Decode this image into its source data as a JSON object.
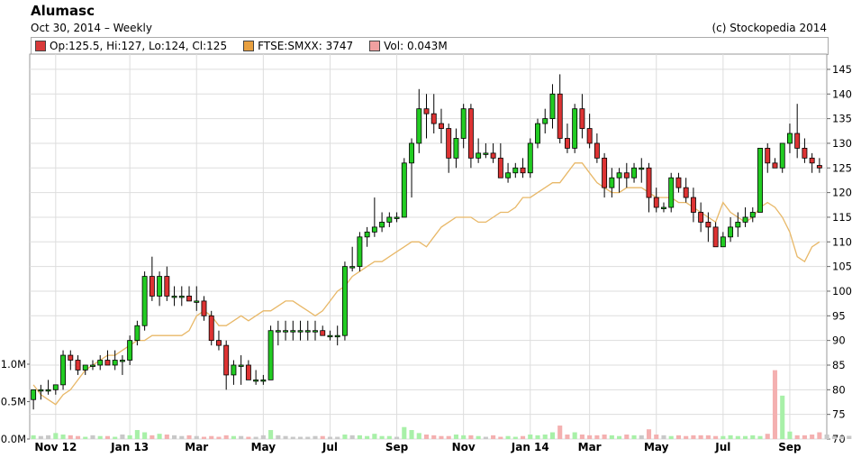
{
  "header": {
    "title": "Alumasc",
    "subtitle": "Oct 30, 2014 – Weekly",
    "copyright": "(c) Stockopedia 2014"
  },
  "legend": [
    {
      "label": "Op:125.5, Hi:127, Lo:124, Cl:125",
      "color": "#d93a3a"
    },
    {
      "label": "FTSE:SMXX: 3747",
      "color": "#e8a040"
    },
    {
      "label": "Vol: 0.043M",
      "color": "#f0a0a0"
    }
  ],
  "colors": {
    "up": "#22cc22",
    "down": "#dd3333",
    "ftse": "#e8b868",
    "vol_up": "#a8f0a8",
    "vol_down": "#f4b0b0",
    "vol_neutral": "#c8c8c8",
    "grid": "#dddddd"
  },
  "chart_data": {
    "type": "candlestick",
    "title": "Alumasc",
    "price_axis": {
      "ticks": [
        70,
        75,
        80,
        85,
        90,
        95,
        100,
        105,
        110,
        115,
        120,
        125,
        130,
        135,
        140,
        145
      ],
      "range": [
        70,
        147
      ]
    },
    "volume_axis": {
      "tick_labels": [
        "0.0M",
        "0.5M",
        "1.0M"
      ],
      "ticks": [
        0,
        0.5,
        1.0
      ]
    },
    "x_labels": [
      "Nov 12",
      "Jan 13",
      "Mar",
      "May",
      "Jul",
      "Sep",
      "Nov",
      "Jan 14",
      "Mar",
      "May",
      "Jul",
      "Sep"
    ],
    "x_label_weeks": [
      3,
      13,
      22,
      31,
      40,
      49,
      58,
      67,
      75,
      84,
      93,
      102
    ],
    "x_label_bold": [
      true,
      true,
      false,
      false,
      false,
      false,
      false,
      true,
      false,
      false,
      false,
      false
    ],
    "ohlc": [
      [
        78,
        80,
        76,
        80
      ],
      [
        80,
        81,
        78,
        80
      ],
      [
        80,
        82,
        79,
        80
      ],
      [
        80,
        81,
        79,
        81
      ],
      [
        81,
        88,
        80,
        87
      ],
      [
        87,
        88,
        84,
        86
      ],
      [
        86,
        87,
        83,
        84
      ],
      [
        84,
        85,
        83,
        85
      ],
      [
        85,
        86,
        84,
        85
      ],
      [
        85,
        87,
        84,
        86
      ],
      [
        86,
        88,
        85,
        85
      ],
      [
        85,
        88,
        84,
        86
      ],
      [
        86,
        87,
        83,
        86
      ],
      [
        86,
        91,
        85,
        90
      ],
      [
        90,
        94,
        89,
        93
      ],
      [
        93,
        104,
        92,
        103
      ],
      [
        103,
        107,
        98,
        99
      ],
      [
        99,
        104,
        97,
        103
      ],
      [
        103,
        105,
        98,
        99
      ],
      [
        99,
        101,
        97,
        99
      ],
      [
        99,
        101,
        97,
        99
      ],
      [
        99,
        101,
        98,
        98
      ],
      [
        98,
        101,
        96,
        98
      ],
      [
        98,
        99,
        94,
        95
      ],
      [
        95,
        96,
        89,
        90
      ],
      [
        90,
        92,
        88,
        89
      ],
      [
        89,
        90,
        80,
        83
      ],
      [
        83,
        86,
        81,
        85
      ],
      [
        85,
        87,
        81,
        85
      ],
      [
        85,
        86,
        82,
        82
      ],
      [
        82,
        84,
        81,
        82
      ],
      [
        82,
        83,
        81,
        82
      ],
      [
        82,
        93,
        82,
        92
      ],
      [
        92,
        94,
        89,
        92
      ],
      [
        92,
        94,
        90,
        92
      ],
      [
        92,
        94,
        90,
        92
      ],
      [
        92,
        94,
        90,
        92
      ],
      [
        92,
        94,
        90,
        92
      ],
      [
        92,
        94,
        90,
        92
      ],
      [
        92,
        93,
        91,
        91
      ],
      [
        91,
        92,
        90,
        91
      ],
      [
        91,
        93,
        89,
        91
      ],
      [
        91,
        106,
        90,
        105
      ],
      [
        105,
        109,
        104,
        105
      ],
      [
        105,
        112,
        104,
        111
      ],
      [
        111,
        113,
        109,
        112
      ],
      [
        112,
        119,
        111,
        113
      ],
      [
        113,
        116,
        112,
        114
      ],
      [
        114,
        116,
        113,
        115
      ],
      [
        115,
        116,
        114,
        115
      ],
      [
        115,
        127,
        115,
        126
      ],
      [
        126,
        131,
        119,
        130
      ],
      [
        130,
        141,
        128,
        137
      ],
      [
        137,
        140,
        131,
        136
      ],
      [
        136,
        140,
        132,
        134
      ],
      [
        134,
        137,
        130,
        133
      ],
      [
        133,
        134,
        124,
        127
      ],
      [
        127,
        133,
        125,
        131
      ],
      [
        131,
        138,
        129,
        137
      ],
      [
        137,
        138,
        125,
        127
      ],
      [
        127,
        131,
        126,
        128
      ],
      [
        128,
        130,
        127,
        128
      ],
      [
        128,
        130,
        126,
        127
      ],
      [
        127,
        130,
        123,
        123
      ],
      [
        123,
        126,
        122,
        124
      ],
      [
        124,
        126,
        123,
        125
      ],
      [
        125,
        127,
        123,
        124
      ],
      [
        124,
        131,
        123,
        130
      ],
      [
        130,
        135,
        129,
        134
      ],
      [
        134,
        137,
        132,
        135
      ],
      [
        135,
        142,
        133,
        140
      ],
      [
        140,
        144,
        130,
        131
      ],
      [
        131,
        134,
        128,
        129
      ],
      [
        129,
        138,
        128,
        137
      ],
      [
        137,
        140,
        131,
        133
      ],
      [
        133,
        136,
        129,
        130
      ],
      [
        130,
        132,
        126,
        127
      ],
      [
        127,
        128,
        119,
        121
      ],
      [
        121,
        125,
        119,
        123
      ],
      [
        123,
        125,
        120,
        124
      ],
      [
        124,
        126,
        121,
        123
      ],
      [
        123,
        126,
        122,
        125
      ],
      [
        125,
        127,
        122,
        125
      ],
      [
        125,
        126,
        116,
        119
      ],
      [
        119,
        121,
        116,
        117
      ],
      [
        117,
        118,
        116,
        117
      ],
      [
        117,
        124,
        116,
        123
      ],
      [
        123,
        124,
        120,
        121
      ],
      [
        121,
        123,
        118,
        119
      ],
      [
        119,
        121,
        114,
        116
      ],
      [
        116,
        118,
        112,
        114
      ],
      [
        114,
        116,
        110,
        113
      ],
      [
        113,
        114,
        109,
        109
      ],
      [
        109,
        112,
        109,
        111
      ],
      [
        111,
        115,
        110,
        113
      ],
      [
        113,
        116,
        111,
        114
      ],
      [
        114,
        117,
        113,
        115
      ],
      [
        115,
        117,
        114,
        116
      ],
      [
        116,
        129,
        116,
        129
      ],
      [
        129,
        130,
        124,
        126
      ],
      [
        126,
        127,
        125,
        125
      ],
      [
        125,
        130,
        124,
        130
      ],
      [
        130,
        134,
        128,
        132
      ],
      [
        132,
        138,
        127,
        129
      ],
      [
        129,
        131,
        126,
        127
      ],
      [
        127,
        128,
        124,
        126
      ],
      [
        125.5,
        127,
        124,
        125
      ]
    ],
    "ftse": [
      81,
      79,
      78,
      77,
      79,
      80,
      82,
      84,
      85,
      86,
      87,
      87,
      88,
      89,
      90,
      90,
      91,
      91,
      91,
      91,
      91,
      92,
      95,
      96,
      95,
      93,
      93,
      94,
      95,
      94,
      95,
      96,
      96,
      97,
      98,
      98,
      97,
      96,
      95,
      96,
      98,
      100,
      101,
      103,
      104,
      105,
      106,
      106,
      107,
      108,
      109,
      110,
      110,
      109,
      111,
      113,
      114,
      115,
      115,
      115,
      114,
      114,
      115,
      116,
      116,
      117,
      119,
      119,
      120,
      121,
      122,
      122,
      124,
      126,
      126,
      124,
      122,
      121,
      120,
      120,
      121,
      121,
      121,
      120,
      119,
      119,
      119,
      118,
      118,
      117,
      116,
      115,
      114,
      118,
      116,
      115,
      114,
      115,
      117,
      118,
      117,
      115,
      112,
      107,
      106,
      109,
      110
    ],
    "volume": [
      0.05,
      0.04,
      0.05,
      0.08,
      0.06,
      0.05,
      0.04,
      0.03,
      0.05,
      0.04,
      0.04,
      0.03,
      0.06,
      0.05,
      0.12,
      0.09,
      0.05,
      0.07,
      0.06,
      0.05,
      0.04,
      0.05,
      0.04,
      0.03,
      0.04,
      0.03,
      0.05,
      0.04,
      0.04,
      0.03,
      0.03,
      0.05,
      0.12,
      0.05,
      0.04,
      0.03,
      0.03,
      0.03,
      0.04,
      0.04,
      0.03,
      0.03,
      0.06,
      0.05,
      0.05,
      0.04,
      0.07,
      0.04,
      0.04,
      0.03,
      0.16,
      0.12,
      0.08,
      0.06,
      0.05,
      0.04,
      0.04,
      0.06,
      0.05,
      0.05,
      0.04,
      0.03,
      0.05,
      0.03,
      0.04,
      0.03,
      0.04,
      0.06,
      0.05,
      0.06,
      0.09,
      0.18,
      0.06,
      0.09,
      0.06,
      0.05,
      0.05,
      0.06,
      0.05,
      0.04,
      0.06,
      0.05,
      0.05,
      0.13,
      0.06,
      0.05,
      0.04,
      0.05,
      0.04,
      0.05,
      0.05,
      0.05,
      0.04,
      0.04,
      0.05,
      0.04,
      0.04,
      0.05,
      0.04,
      0.07,
      0.92,
      0.58,
      0.1,
      0.05,
      0.05,
      0.06,
      0.09,
      0.06,
      0.04,
      0.04,
      0.043
    ]
  }
}
